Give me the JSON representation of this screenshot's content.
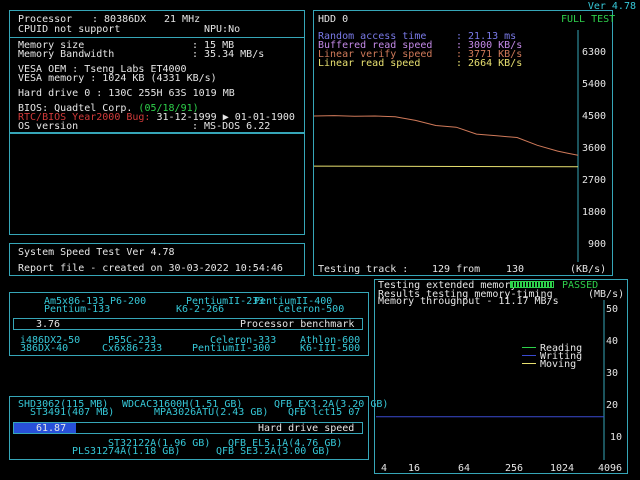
{
  "version": "Ver 4.78",
  "sys": {
    "processor_label": "Processor",
    "processor_value": ": 80386DX",
    "processor_freq": "21 MHz",
    "cpuid": "CPUID not support",
    "npu": "NPU:No",
    "mem_size_label": "Memory size",
    "mem_size_value": ":     15 MB",
    "mem_bw_label": "Memory Bandwidth",
    "mem_bw_value": ":   35.34 MB/s",
    "vesa_oem": "VESA OEM : Tseng Labs ET4000",
    "vesa_mem": "VESA memory : 1024 KB (4331 KB/s)",
    "hdd": "Hard drive 0 : 130C 255H 63S     1019 MB",
    "bios_prefix": "BIOS: Quadtel Corp. ",
    "bios_date": "(05/18/91)",
    "y2k_label": "RTC/BIOS Year2000 Bug: ",
    "y2k_value": "31-12-1999 ▶ 01-01-1900",
    "os_label": "OS version",
    "os_value": ":  MS-DOS 6.22"
  },
  "speed": {
    "line1": "System Speed Test  Ver 4.78",
    "line2": "Report file - created on 30-03-2022 10:54:46"
  },
  "hdd_panel": {
    "title": "HDD 0",
    "mode": "FULL TEST",
    "random_label": "Random access time",
    "random_value": ":   21.13 ms",
    "buffered_label": "Buffered read speed",
    "buffered_value": ":   3000 KB/s",
    "verify_label": "Linear verify speed",
    "verify_value": ":   3771 KB/s",
    "linear_label": "Linear read speed",
    "linear_value": ":   2664 KB/s",
    "track_label": "Testing track :",
    "track_value": "129 from",
    "track_total": "130",
    "unit": "(KB/s)",
    "yticks": [
      "6300",
      "5400",
      "4500",
      "3600",
      "2700",
      "1800",
      "900"
    ]
  },
  "mem_panel": {
    "line1": "Testing extended memory...",
    "passed": "PASSED",
    "line2": "Results testing memory-timing",
    "unit": "(MB/s)",
    "line3": "Memory throughput   -  11.17 MB/s",
    "legend_reading": "Reading",
    "legend_writing": "Writing",
    "legend_moving": "Moving",
    "yticks": [
      "50",
      "40",
      "30",
      "20",
      "10"
    ],
    "xticks": [
      "4",
      "16",
      "64",
      "256",
      "1024",
      "4096"
    ]
  },
  "cpu_bench": {
    "top1": [
      "Am5x86-133",
      "P6-200",
      "PentiumII-233",
      "PentiumII-400"
    ],
    "top2": [
      "Pentium-133",
      "K6-2-266",
      "Celeron-500"
    ],
    "value": "3.76",
    "title": "Processor benchmark",
    "bot1": [
      "i486DX2-50",
      "P55C-233",
      "Celeron-333",
      "Athlon-600"
    ],
    "bot2": [
      "386DX-40",
      "Cx6x86-233",
      "PentiumII-300",
      "K6-III-500"
    ]
  },
  "hdd_bench": {
    "top1": [
      "SHD3062(115 MB)",
      "WDCAC31600H(1.51 GB)",
      "QFB EX3.2A(3.20 GB)"
    ],
    "top2": [
      "ST3491(407 MB)",
      "MPA3026ATU(2.43 GB)",
      "QFB lct15 07"
    ],
    "value": "61.87",
    "title": "Hard drive speed",
    "bot1": [
      "ST32122A(1.96 GB)",
      "QFB EL5.1A(4.76 GB)"
    ],
    "bot2": [
      "PLS31274A(1.18 GB)",
      "QFB SE3.2A(3.00 GB)"
    ]
  },
  "chart_data": [
    {
      "type": "line",
      "title": "HDD 0",
      "ylabel": "(KB/s)",
      "ylim": [
        0,
        6800
      ],
      "x_label": "Testing track",
      "series": [
        {
          "name": "Linear verify speed",
          "color": "#d07a5a",
          "x": [
            0,
            10,
            20,
            30,
            40,
            50,
            60,
            70,
            80,
            90,
            100,
            110,
            120,
            125,
            130
          ],
          "values": [
            4280,
            4290,
            4270,
            4280,
            4260,
            4150,
            4000,
            3950,
            3750,
            3700,
            3650,
            3420,
            3250,
            3190,
            3130
          ]
        },
        {
          "name": "Linear read speed",
          "color": "#e8e070",
          "x": [
            0,
            130
          ],
          "values": [
            2810,
            2790
          ]
        }
      ]
    },
    {
      "type": "line",
      "title": "Results testing memory-timing",
      "ylabel": "(MB/s)",
      "ylim": [
        0,
        50
      ],
      "xticks": [
        "4",
        "16",
        "64",
        "256",
        "1024",
        "4096"
      ],
      "series": [
        {
          "name": "Writing",
          "color": "#3a4ad0",
          "x": [
            4,
            4096
          ],
          "values": [
            13.5,
            13.5
          ]
        }
      ]
    }
  ]
}
